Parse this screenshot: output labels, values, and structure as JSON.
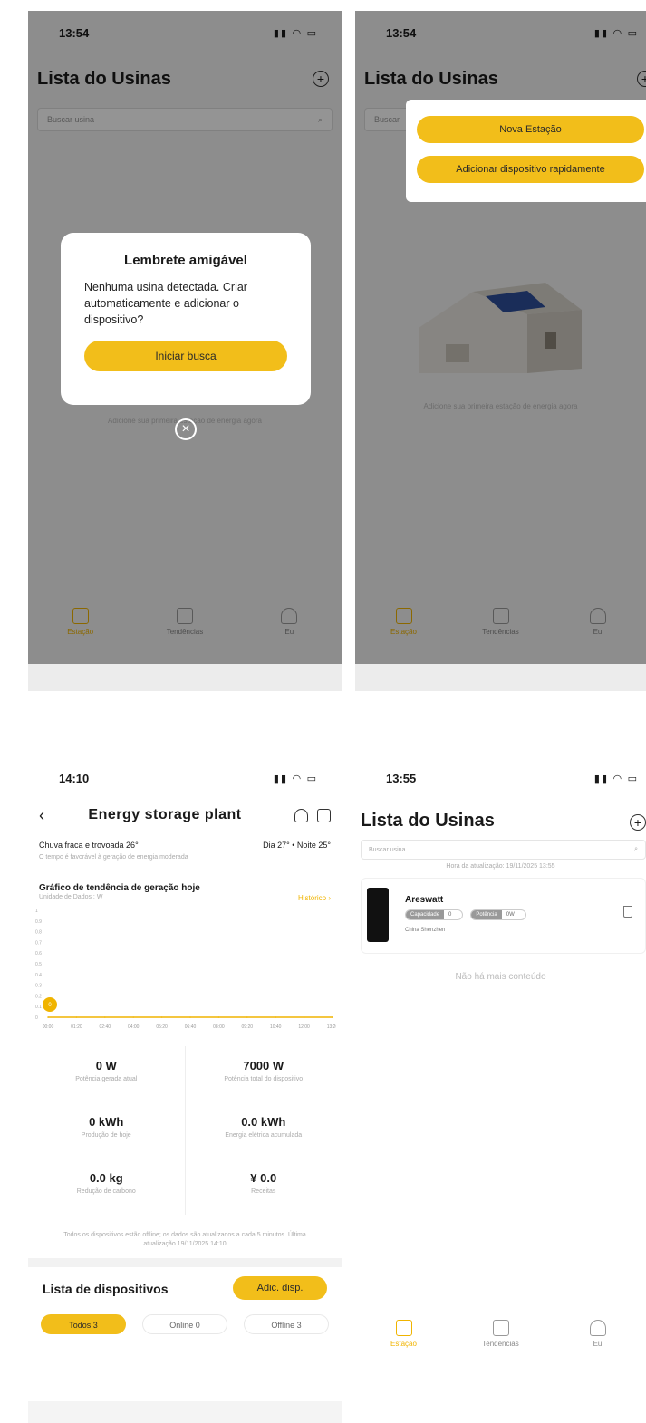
{
  "screen1": {
    "time": "13:54",
    "title": "Lista do Usinas",
    "search_placeholder": "Buscar usina",
    "modal": {
      "title": "Lembrete amigável",
      "message": "Nenhuma usina detectada. Criar automaticamente e adicionar o dispositivo?",
      "button": "Iniciar busca"
    },
    "hint": "Adicione sua primeira estação de energia agora",
    "tabs": [
      "Estação",
      "Tendências",
      "Eu"
    ]
  },
  "screen2": {
    "time": "13:54",
    "title": "Lista do Usinas",
    "search_placeholder": "Buscar",
    "menu": [
      "Nova Estação",
      "Adicionar dispositivo rapidamente"
    ],
    "hint": "Adicione sua primeira estação de energia agora",
    "tabs": [
      "Estação",
      "Tendências",
      "Eu"
    ]
  },
  "screen3": {
    "time": "14:10",
    "title": "Energy storage plant",
    "weather_left": "Chuva fraca e trovoada 26°",
    "weather_right": "Dia 27° • Noite 25°",
    "weather_note": "O tempo é favorável à geração de energia moderada",
    "chart_title": "Gráfico de tendência de geração hoje",
    "chart_unit": "Unidade de Dados : W",
    "history_link": "Histórico",
    "stats": [
      {
        "value": "0 W",
        "label": "Potência gerada atual"
      },
      {
        "value": "7000 W",
        "label": "Potência total do dispositivo"
      },
      {
        "value": "0 kWh",
        "label": "Produção de hoje"
      },
      {
        "value": "0.0 kWh",
        "label": "Energia elétrica acumulada"
      },
      {
        "value": "0.0 kg",
        "label": "Redução de carbono"
      },
      {
        "value": "¥ 0.0",
        "label": "Receitas"
      }
    ],
    "footnote": "Todos os dispositivos estão offline; os dados são atualizados a cada 5 minutos. Última atualização 19/11/2025 14:10",
    "device_list_title": "Lista de dispositivos",
    "add_device": "Adic. disp.",
    "filters": [
      "Todos 3",
      "Online 0",
      "Offline 3"
    ]
  },
  "screen4": {
    "time": "13:55",
    "title": "Lista do Usinas",
    "search_placeholder": "Buscar usina",
    "update_time": "Hora da atualização: 19/11/2025 13:55",
    "plant": {
      "name": "Areswatt",
      "badge1_key": "Capacidade",
      "badge1_val": "0",
      "badge2_key": "Potência",
      "badge2_val": "0W",
      "location": "China Shenzhen"
    },
    "no_more": "Não há mais conteúdo",
    "tabs": [
      "Estação",
      "Tendências",
      "Eu"
    ]
  },
  "chart_data": {
    "type": "line",
    "x": [
      "00:00",
      "01:20",
      "02:40",
      "04:00",
      "05:20",
      "06:40",
      "08:00",
      "09:20",
      "10:40",
      "12:00",
      "13:20"
    ],
    "y_ticks": [
      0,
      0.1,
      0.2,
      0.3,
      0.4,
      0.5,
      0.6,
      0.7,
      0.8,
      0.9,
      1
    ],
    "values": [
      0,
      0,
      0,
      0,
      0,
      0,
      0,
      0,
      0,
      0,
      0
    ],
    "marker_value": "0",
    "ylim": [
      0,
      1
    ],
    "color": "#f0b400",
    "legend": "none"
  }
}
